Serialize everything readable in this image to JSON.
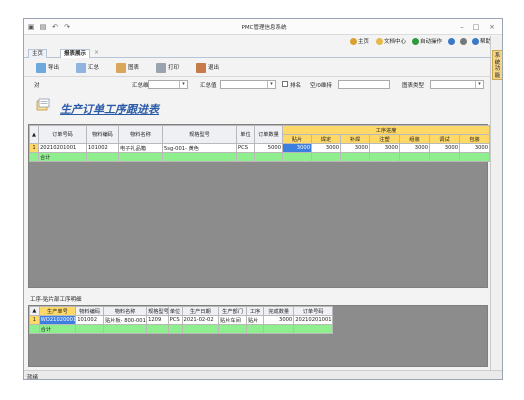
{
  "window": {
    "title": "PMC管理信息系统"
  },
  "header_links": [
    {
      "label": "主页"
    },
    {
      "label": "文档中心"
    },
    {
      "label": "自动操作"
    },
    {
      "label": "帮助"
    }
  ],
  "tabs": [
    {
      "label": "主页"
    },
    {
      "label": "报表展示"
    }
  ],
  "toolbar": [
    {
      "label": "导出"
    },
    {
      "label": "汇总"
    },
    {
      "label": "图表"
    },
    {
      "label": "打印"
    },
    {
      "label": "退出"
    }
  ],
  "filter": {
    "label_1": "对",
    "label_2": "汇总维度",
    "label_3": "汇总值",
    "checkbox_label": "排名",
    "label_4": "空/0维持",
    "label_5": "图表类型"
  },
  "report": {
    "title": "生产订单工序跟进表"
  },
  "main_table": {
    "columns": [
      "订单号码",
      "物料编码",
      "物料名称",
      "规格型号",
      "单位",
      "订单数量"
    ],
    "progress_header": "工序进度",
    "progress_columns": [
      "贴片",
      "焊定",
      "补焊",
      "注塑",
      "组装",
      "调试",
      "包装"
    ],
    "rows": [
      {
        "index": "1",
        "cells": [
          "20210201001",
          "101002",
          "电子礼品箱",
          "5sg-001- 黄色",
          "PCS",
          "5000"
        ],
        "progress": [
          "3000",
          "3000",
          "3000",
          "3000",
          "3000",
          "3000",
          "3000"
        ]
      }
    ],
    "total_label": "合计"
  },
  "detail": {
    "label": "工序-贴片部工序明细",
    "columns": [
      "生产单号",
      "物料编码",
      "物料名称",
      "规格型号",
      "单位",
      "生产日期",
      "生产部门",
      "工序",
      "完成数量",
      "订单号码"
    ],
    "rows": [
      {
        "index": "1",
        "cells": [
          "WO21020001",
          "101002",
          "贴片板- 800-001",
          "1209",
          "PCS",
          "2021-02-02",
          "贴片车间",
          "贴片",
          "3000",
          "20210201001"
        ]
      }
    ],
    "total_label": "合计"
  },
  "rightbar": {
    "label": "系统功能"
  },
  "status": {
    "text": "就绪"
  }
}
